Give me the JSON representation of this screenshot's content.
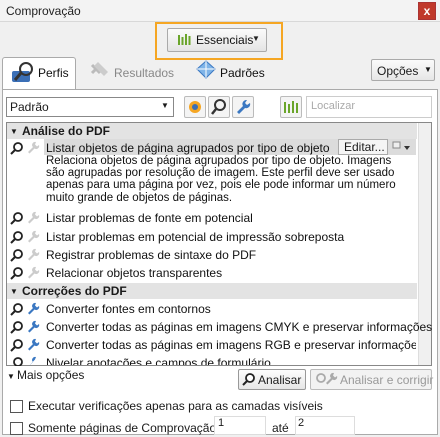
{
  "window": {
    "title": "Comprovação",
    "close_glyph": "x"
  },
  "profile_selector": {
    "label": "Essenciais"
  },
  "tabs": [
    {
      "label": "Perfis",
      "icon": "profiles-icon",
      "active": true
    },
    {
      "label": "Resultados",
      "icon": "results-icon",
      "active": false
    },
    {
      "label": "Padrões",
      "icon": "standards-icon",
      "active": false
    }
  ],
  "options_button": {
    "label": "Opções"
  },
  "filter": {
    "selected": "Padrão",
    "find_placeholder": "Localizar"
  },
  "groups": [
    {
      "label": "Análise do PDF",
      "items": [
        {
          "label": "Listar objetos de página agrupados por tipo de objeto",
          "selected": true,
          "edit_label": "Editar...",
          "description": "Relaciona objetos de página agrupados por tipo de objeto. Imagens são agrupadas por resolução de imagem. Este perfil deve ser usado apenas para uma página por vez, pois ele pode informar um número muito grande de objetos de páginas."
        },
        {
          "label": "Listar problemas de fonte em potencial"
        },
        {
          "label": "Listar problemas em potencial de impressão sobreposta"
        },
        {
          "label": "Registrar problemas de sintaxe do PDF"
        },
        {
          "label": "Relacionar objetos transparentes"
        }
      ]
    },
    {
      "label": "Correções do PDF",
      "items": [
        {
          "label": "Converter fontes em contornos"
        },
        {
          "label": "Converter todas as páginas em imagens CMYK e preservar informações"
        },
        {
          "label": "Converter todas as páginas em imagens RGB e preservar informações d"
        },
        {
          "label": "Nivelar anotações e campos de formulário"
        }
      ]
    }
  ],
  "more_options": {
    "label": "Mais opções"
  },
  "actions": {
    "analyze": "Analisar",
    "analyze_fix": "Analisar e corrigir"
  },
  "checkboxes": [
    {
      "label": "Executar verificações apenas para as camadas visíveis",
      "checked": false
    },
    {
      "label": "Somente páginas de Comprovação",
      "checked": false
    }
  ],
  "page_range": {
    "from": "1",
    "to_label": "até",
    "to": "2"
  },
  "colors": {
    "accent_orange": "#f5a623",
    "close_red": "#c0392b",
    "icon_green": "#6aa52a"
  }
}
